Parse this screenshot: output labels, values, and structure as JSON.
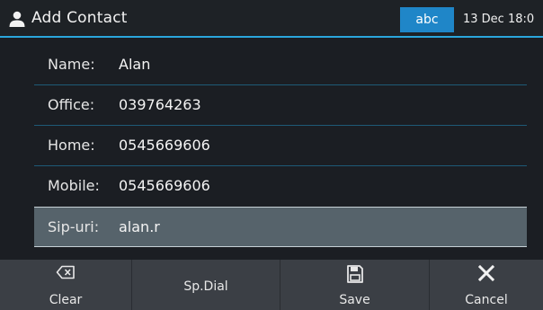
{
  "header": {
    "title": "Add Contact",
    "input_mode": "abc",
    "datetime": "13 Dec 18:0",
    "icon": "person-icon",
    "accent_color": "#2aa6dc"
  },
  "form": {
    "fields": [
      {
        "label": "Name:",
        "value": "Alan"
      },
      {
        "label": "Office:",
        "value": "039764263"
      },
      {
        "label": "Home:",
        "value": "0545669606"
      },
      {
        "label": "Mobile:",
        "value": "0545669606"
      },
      {
        "label": "Sip-uri:",
        "value": "alan.r",
        "selected": true
      }
    ]
  },
  "softkeys": [
    {
      "label": "Clear",
      "icon": "backspace-icon"
    },
    {
      "label": "Sp.Dial",
      "icon": ""
    },
    {
      "label": "Save",
      "icon": "save-icon"
    },
    {
      "label": "Cancel",
      "icon": "close-icon"
    }
  ]
}
